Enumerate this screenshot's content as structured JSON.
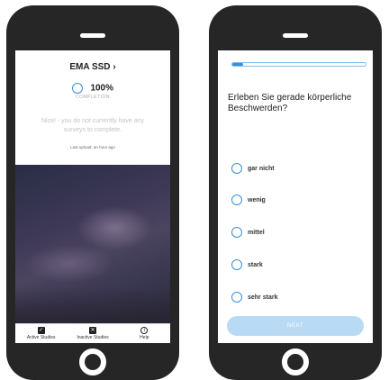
{
  "left_screen": {
    "title": "EMA SSD",
    "title_chevron": "›",
    "completion_percent": "100%",
    "completion_label": "COMPLETION",
    "message": "Nice! - you do not currently have any surveys to complete.",
    "last_upload": "Last upload: an hour ago",
    "tabs": [
      {
        "label": "Active Studies",
        "icon": "check-box-icon"
      },
      {
        "label": "Inactive Studies",
        "icon": "x-box-icon"
      },
      {
        "label": "Help",
        "icon": "info-icon"
      }
    ]
  },
  "right_screen": {
    "progress": 0.08,
    "question": "Erleben Sie gerade körperliche Beschwerden?",
    "options": [
      "gar nicht",
      "wenig",
      "mittel",
      "stark",
      "sehr stark"
    ],
    "next_label": "NEXT"
  },
  "colors": {
    "accent": "#3a8fd8",
    "phone_body": "#262626",
    "next_disabled": "#b9daf4"
  }
}
